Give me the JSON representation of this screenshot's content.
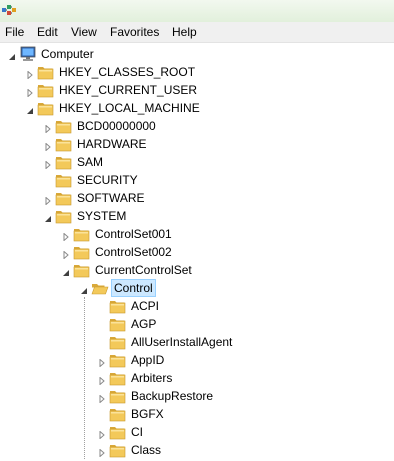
{
  "menu": [
    "File",
    "Edit",
    "View",
    "Favorites",
    "Help"
  ],
  "tree": [
    {
      "label": "Computer",
      "depth": 0,
      "state": "open",
      "icon": "computer-icon"
    },
    {
      "label": "HKEY_CLASSES_ROOT",
      "depth": 1,
      "state": "closed",
      "icon": "folder-icon"
    },
    {
      "label": "HKEY_CURRENT_USER",
      "depth": 1,
      "state": "closed",
      "icon": "folder-icon"
    },
    {
      "label": "HKEY_LOCAL_MACHINE",
      "depth": 1,
      "state": "open",
      "icon": "folder-icon"
    },
    {
      "label": "BCD00000000",
      "depth": 2,
      "state": "closed",
      "icon": "folder-icon"
    },
    {
      "label": "HARDWARE",
      "depth": 2,
      "state": "closed",
      "icon": "folder-icon"
    },
    {
      "label": "SAM",
      "depth": 2,
      "state": "closed",
      "icon": "folder-icon"
    },
    {
      "label": "SECURITY",
      "depth": 2,
      "state": "none",
      "icon": "folder-icon"
    },
    {
      "label": "SOFTWARE",
      "depth": 2,
      "state": "closed",
      "icon": "folder-icon"
    },
    {
      "label": "SYSTEM",
      "depth": 2,
      "state": "open",
      "icon": "folder-icon"
    },
    {
      "label": "ControlSet001",
      "depth": 3,
      "state": "closed",
      "icon": "folder-icon"
    },
    {
      "label": "ControlSet002",
      "depth": 3,
      "state": "closed",
      "icon": "folder-icon"
    },
    {
      "label": "CurrentControlSet",
      "depth": 3,
      "state": "open",
      "icon": "folder-icon"
    },
    {
      "label": "Control",
      "depth": 4,
      "state": "open",
      "icon": "folder-open-icon",
      "selected": true
    },
    {
      "label": "ACPI",
      "depth": 5,
      "state": "none",
      "icon": "folder-icon"
    },
    {
      "label": "AGP",
      "depth": 5,
      "state": "none",
      "icon": "folder-icon"
    },
    {
      "label": "AllUserInstallAgent",
      "depth": 5,
      "state": "none",
      "icon": "folder-icon"
    },
    {
      "label": "AppID",
      "depth": 5,
      "state": "closed",
      "icon": "folder-icon"
    },
    {
      "label": "Arbiters",
      "depth": 5,
      "state": "closed",
      "icon": "folder-icon"
    },
    {
      "label": "BackupRestore",
      "depth": 5,
      "state": "closed",
      "icon": "folder-icon"
    },
    {
      "label": "BGFX",
      "depth": 5,
      "state": "none",
      "icon": "folder-icon"
    },
    {
      "label": "CI",
      "depth": 5,
      "state": "closed",
      "icon": "folder-icon"
    },
    {
      "label": "Class",
      "depth": 5,
      "state": "closed",
      "icon": "folder-icon"
    }
  ],
  "colors": {
    "selection": "#cce8ff",
    "folder": "#f3c95a"
  }
}
